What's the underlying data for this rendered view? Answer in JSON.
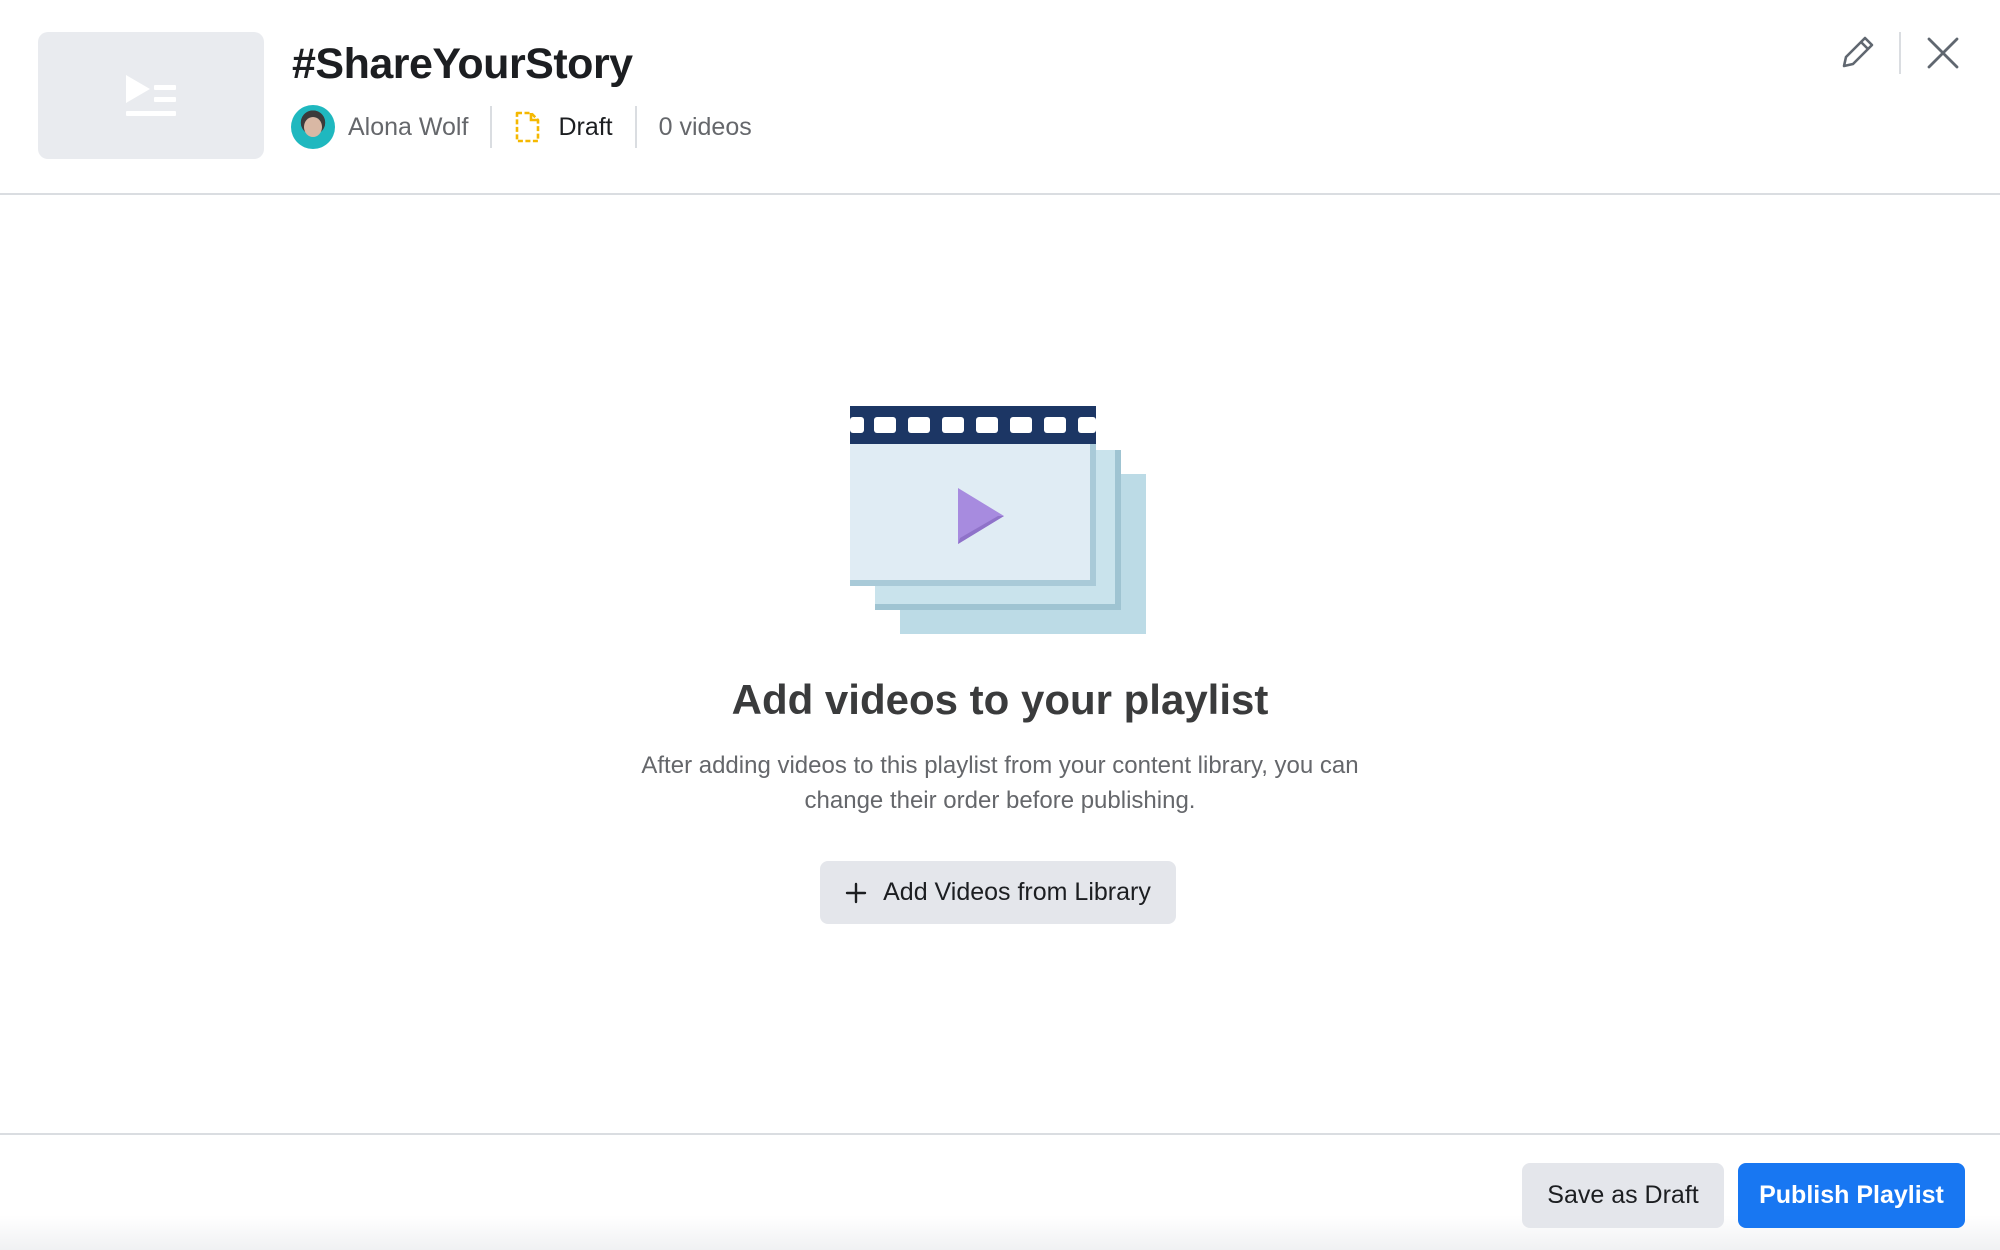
{
  "header": {
    "title": "#ShareYourStory",
    "author": "Alona Wolf",
    "status": "Draft",
    "video_count": "0 videos",
    "thumbnail_icon": "playlist-icon",
    "status_icon": "draft-document-icon",
    "edit_icon": "pencil-icon",
    "close_icon": "close-icon"
  },
  "empty_state": {
    "title": "Add videos to your playlist",
    "description": "After adding videos to this playlist from your content library, you can change their order before publishing.",
    "add_button_label": "Add Videos from Library",
    "add_button_icon": "plus-icon",
    "illustration": "film-stack-illustration"
  },
  "footer": {
    "save_draft_label": "Save as Draft",
    "publish_label": "Publish Playlist"
  },
  "colors": {
    "primary": "#1877f2",
    "draft_icon": "#f5b800",
    "film_strip": "#1c3664",
    "play": "#a78bdf"
  }
}
